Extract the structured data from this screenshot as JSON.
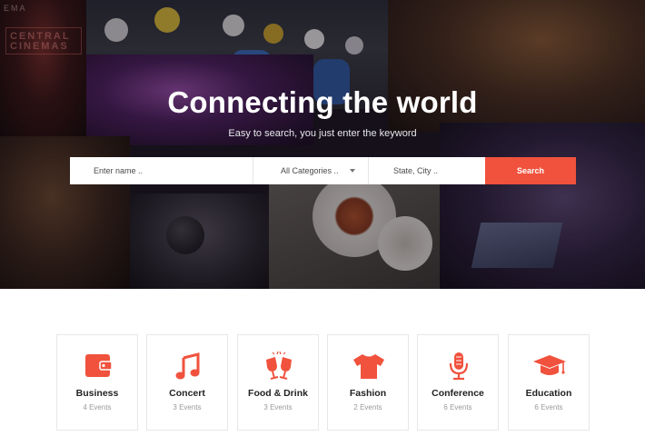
{
  "hero": {
    "title": "Connecting the world",
    "subtitle": "Easy to search, you just enter the keyword",
    "cinema_sign_top": "EMA",
    "cinema_sign": "CENTRAL CINEMAS"
  },
  "search": {
    "name_placeholder": "Enter name ..",
    "category_selected": "All Categories ..",
    "location_placeholder": "State, City ..",
    "button_label": "Search"
  },
  "categories": [
    {
      "name": "Business",
      "count": "4 Events",
      "icon": "wallet-icon"
    },
    {
      "name": "Concert",
      "count": "3 Events",
      "icon": "music-note-icon"
    },
    {
      "name": "Food & Drink",
      "count": "3 Events",
      "icon": "cheers-glasses-icon"
    },
    {
      "name": "Fashion",
      "count": "2 Events",
      "icon": "t-shirt-icon"
    },
    {
      "name": "Conference",
      "count": "6 Events",
      "icon": "microphone-icon"
    },
    {
      "name": "Education",
      "count": "6 Events",
      "icon": "graduation-cap-icon"
    }
  ],
  "colors": {
    "accent": "#f0523d",
    "card_border": "#e7e7e7",
    "muted_text": "#999999"
  }
}
